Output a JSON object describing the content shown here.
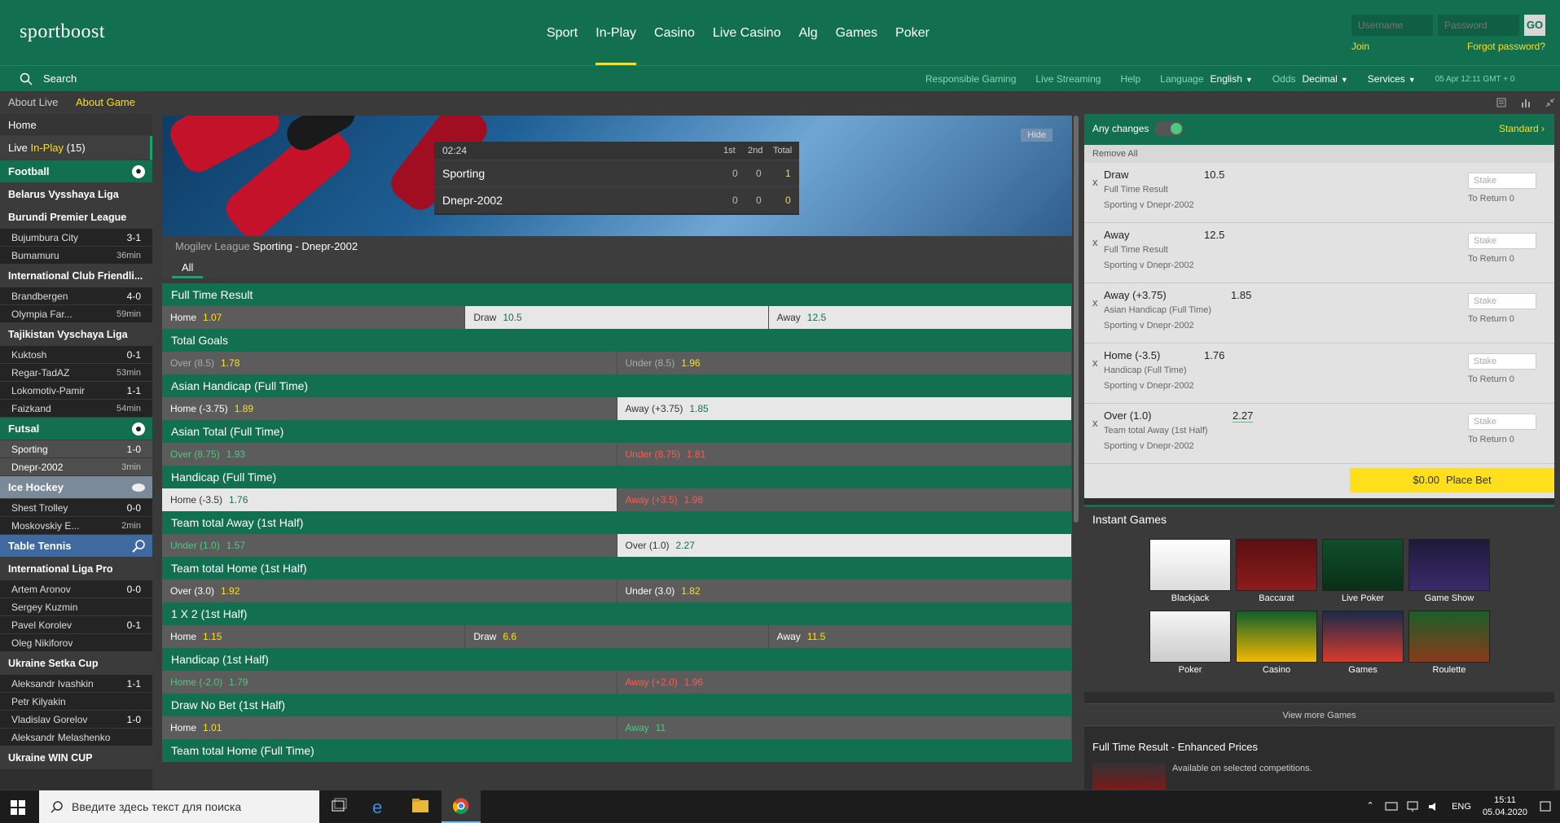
{
  "brand": {
    "logo": "sportboost"
  },
  "nav": [
    "Sport",
    "In-Play",
    "Casino",
    "Live Casino",
    "Alg",
    "Games",
    "Poker"
  ],
  "nav_active": "In-Play",
  "login": {
    "username_placeholder": "Username",
    "password_placeholder": "Password",
    "go": "GO",
    "join": "Join",
    "forgot": "Forgot password?"
  },
  "subbar": {
    "search": "Search",
    "links": [
      "Responsible Gaming",
      "Live Streaming",
      "Help"
    ],
    "language_label": "Language",
    "language": "English",
    "odds_label": "Odds",
    "odds": "Decimal",
    "services": "Services",
    "datetime": "05 Apr 12:11 GMT + 0"
  },
  "about": {
    "live": "About Live",
    "game": "About Game"
  },
  "sidebar": {
    "home": "Home",
    "live_prefix": "Live",
    "live_inplay": "In-Play",
    "live_count": "(15)",
    "sections": [
      {
        "type": "sport",
        "label": "Football",
        "icon": "soccer-ball-icon"
      },
      {
        "type": "league",
        "label": "Belarus Vysshaya Liga"
      },
      {
        "type": "league",
        "label": "Burundi Premier League"
      },
      {
        "type": "team",
        "label": "Bujumbura City",
        "score": "3-1"
      },
      {
        "type": "team",
        "label": "Bumamuru",
        "time": "36min"
      },
      {
        "type": "league",
        "label": "International Club Friendli..."
      },
      {
        "type": "team",
        "label": "Brandbergen",
        "score": "4-0"
      },
      {
        "type": "team",
        "label": "Olympia Far...",
        "time": "59min"
      },
      {
        "type": "league",
        "label": "Tajikistan Vyschaya Liga"
      },
      {
        "type": "team",
        "label": "Kuktosh",
        "score": "0-1"
      },
      {
        "type": "team",
        "label": "Regar-TadAZ",
        "time": "53min"
      },
      {
        "type": "team",
        "label": "Lokomotiv-Pamir",
        "score": "1-1"
      },
      {
        "type": "team",
        "label": "Faizkand",
        "time": "54min"
      },
      {
        "type": "sport",
        "label": "Futsal",
        "icon": "futsal-ball-icon"
      },
      {
        "type": "team",
        "label": "Sporting",
        "score": "1-0",
        "selected": true
      },
      {
        "type": "team",
        "label": "Dnepr-2002",
        "time": "3min",
        "selected": true
      },
      {
        "type": "sport",
        "label": "Ice Hockey",
        "icon": "puck-icon",
        "variant": "ice"
      },
      {
        "type": "team",
        "label": "Shest Trolley",
        "score": "0-0"
      },
      {
        "type": "team",
        "label": "Moskovskiy E...",
        "time": "2min"
      },
      {
        "type": "sport",
        "label": "Table Tennis",
        "icon": "paddle-icon",
        "variant": "tt"
      },
      {
        "type": "league",
        "label": "International Liga Pro"
      },
      {
        "type": "team",
        "label": "Artem Aronov",
        "score": "0-0"
      },
      {
        "type": "team",
        "label": "Sergey Kuzmin"
      },
      {
        "type": "team",
        "label": "Pavel Korolev",
        "score": "0-1"
      },
      {
        "type": "team",
        "label": "Oleg Nikiforov"
      },
      {
        "type": "league",
        "label": "Ukraine Setka Cup"
      },
      {
        "type": "team",
        "label": "Aleksandr Ivashkin",
        "score": "1-1"
      },
      {
        "type": "team",
        "label": "Petr Kilyakin"
      },
      {
        "type": "team",
        "label": "Vladislav Gorelov",
        "score": "1-0"
      },
      {
        "type": "team",
        "label": "Aleksandr Melashenko"
      },
      {
        "type": "league",
        "label": "Ukraine WIN CUP"
      }
    ]
  },
  "scoreboard": {
    "clock": "02:24",
    "h1": "1st",
    "h2": "2nd",
    "htot": "Total",
    "hide": "Hide",
    "home": {
      "name": "Sporting",
      "s1": "0",
      "s2": "0",
      "total": "1"
    },
    "away": {
      "name": "Dnepr-2002",
      "s1": "0",
      "s2": "0",
      "total": "0"
    }
  },
  "match": {
    "league": "Mogilev League",
    "title": "Sporting - Dnepr-2002",
    "tab": "All"
  },
  "markets": [
    {
      "title": "Full Time Result",
      "cells": [
        {
          "l": "Home",
          "o": "1.07"
        },
        {
          "l": "Draw",
          "o": "10.5",
          "s": "sel"
        },
        {
          "l": "Away",
          "o": "12.5",
          "s": "sel"
        }
      ]
    },
    {
      "title": "Total Goals",
      "cells": [
        {
          "l": "Over (8.5)",
          "o": "1.78",
          "s": "dim"
        },
        {
          "l": "Under (8.5)",
          "o": "1.96",
          "s": "dim"
        }
      ]
    },
    {
      "title": "Asian Handicap (Full Time)",
      "cells": [
        {
          "l": "Home (-3.75)",
          "o": "1.89"
        },
        {
          "l": "Away (+3.75)",
          "o": "1.85",
          "s": "sel"
        }
      ]
    },
    {
      "title": "Asian Total (Full Time)",
      "cells": [
        {
          "l": "Over (8.75)",
          "o": "1.93",
          "s": "grn"
        },
        {
          "l": "Under (8.75)",
          "o": "1.81",
          "s": "red"
        }
      ]
    },
    {
      "title": "Handicap (Full Time)",
      "cells": [
        {
          "l": "Home (-3.5)",
          "o": "1.76",
          "s": "sel"
        },
        {
          "l": "Away (+3.5)",
          "o": "1.98",
          "s": "red"
        }
      ]
    },
    {
      "title": "Team total Away (1st Half)",
      "cells": [
        {
          "l": "Under (1.0)",
          "o": "1.57",
          "s": "grn"
        },
        {
          "l": "Over (1.0)",
          "o": "2.27",
          "s": "sel"
        }
      ]
    },
    {
      "title": "Team total Home (1st Half)",
      "cells": [
        {
          "l": "Over (3.0)",
          "o": "1.92"
        },
        {
          "l": "Under (3.0)",
          "o": "1.82"
        }
      ]
    },
    {
      "title": "1 X 2 (1st Half)",
      "cells": [
        {
          "l": "Home",
          "o": "1.15"
        },
        {
          "l": "Draw",
          "o": "6.6"
        },
        {
          "l": "Away",
          "o": "11.5"
        }
      ]
    },
    {
      "title": "Handicap (1st Half)",
      "cells": [
        {
          "l": "Home (-2.0)",
          "o": "1.79",
          "s": "grn"
        },
        {
          "l": "Away (+2.0)",
          "o": "1.96",
          "s": "red"
        }
      ]
    },
    {
      "title": "Draw No Bet (1st Half)",
      "cells": [
        {
          "l": "Home",
          "o": "1.01"
        },
        {
          "l": "Away",
          "o": "11",
          "s": "grn"
        }
      ]
    },
    {
      "title": "Team total Home (Full Time)",
      "cells": []
    }
  ],
  "betslip": {
    "any_changes": "Any changes",
    "standard": "Standard",
    "remove_all": "Remove All",
    "bets": [
      {
        "sel": "Draw",
        "odds": "10.5",
        "market": "Full Time Result",
        "event": "Sporting v Dnepr-2002",
        "stake": "Stake",
        "ret": "To Return 0"
      },
      {
        "sel": "Away",
        "odds": "12.5",
        "market": "Full Time Result",
        "event": "Sporting v Dnepr-2002",
        "stake": "Stake",
        "ret": "To Return 0"
      },
      {
        "sel": "Away (+3.75)",
        "odds": "1.85",
        "market": "Asian Handicap (Full Time)",
        "event": "Sporting v Dnepr-2002",
        "stake": "Stake",
        "ret": "To Return 0"
      },
      {
        "sel": "Home (-3.5)",
        "odds": "1.76",
        "market": "Handicap (Full Time)",
        "event": "Sporting v Dnepr-2002",
        "stake": "Stake",
        "ret": "To Return 0"
      },
      {
        "sel": "Over (1.0)",
        "odds": "2.27",
        "market": "Team total Away (1st Half)",
        "event": "Sporting v Dnepr-2002",
        "stake": "Stake",
        "ret": "To Return 0"
      }
    ],
    "amount": "$0.00",
    "place": "Place Bet"
  },
  "instant_games": {
    "title": "Instant Games",
    "games": [
      "Blackjack",
      "Baccarat",
      "Live Poker",
      "Game Show",
      "Poker",
      "Casino",
      "Games",
      "Roulette"
    ],
    "view_more": "View more Games"
  },
  "enhanced": {
    "title": "Full Time Result - Enhanced Prices",
    "desc": "Available on selected competitions."
  },
  "taskbar": {
    "search": "Введите здесь текст для поиска",
    "lang": "ENG",
    "time": "15:11",
    "date": "05.04.2020"
  }
}
